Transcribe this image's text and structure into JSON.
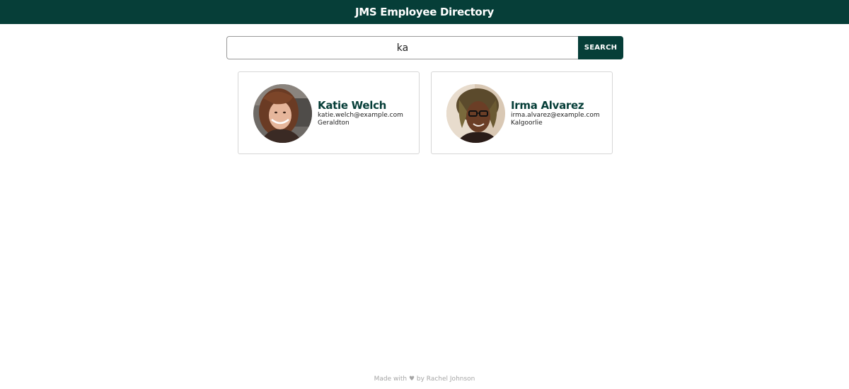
{
  "header": {
    "title": "JMS Employee Directory"
  },
  "search": {
    "value": "ka",
    "button_label": "SEARCH"
  },
  "employees": [
    {
      "name": "Katie Welch",
      "email": "katie.welch@example.com",
      "city": "Geraldton"
    },
    {
      "name": "Irma Alvarez",
      "email": "irma.alvarez@example.com",
      "city": "Kalgoorlie"
    }
  ],
  "footer": {
    "text": "Made with ♥ by Rachel Johnson"
  },
  "colors": {
    "brand": "#063e38",
    "footer_text": "#a5a5a5",
    "card_border": "#d6d6d6"
  }
}
